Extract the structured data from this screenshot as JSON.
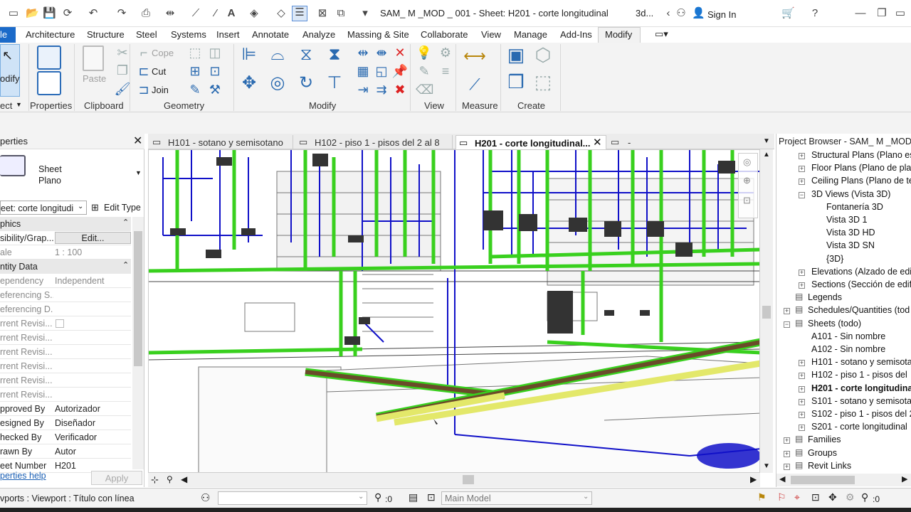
{
  "window_title": "SAM_ M _MOD _ 001 - Sheet: H201 - corte longitudinal",
  "title_extra": "3d...",
  "sign_in": "Sign In",
  "file_tab": "le",
  "tabs": [
    "Architecture",
    "Structure",
    "Steel",
    "Systems",
    "Insert",
    "Annotate",
    "Analyze",
    "Massing & Site",
    "Collaborate",
    "View",
    "Manage",
    "Add-Ins",
    "Modify"
  ],
  "ribbon": {
    "select_label": "odify",
    "select_group": "ect",
    "properties_label": "Properties",
    "clipboard": {
      "paste": "Paste",
      "copy": "Cope",
      "cut": "Cut",
      "join": "Join",
      "group": "Clipboard"
    },
    "geometry_group": "Geometry",
    "modify_group": "Modify",
    "view_group": "View",
    "measure_group": "Measure",
    "create_group": "Create"
  },
  "properties": {
    "title": "perties",
    "type_name": "Sheet",
    "type_sub": "Plano",
    "selector": "eet: corte longitudi",
    "edit_type": "Edit Type",
    "sections": [
      {
        "name": "phics"
      },
      {
        "name": "ntity Data"
      }
    ],
    "rows": [
      {
        "k": "sibility/Grap...",
        "v": "Edit..."
      },
      {
        "k": "ale",
        "v": "1 : 100"
      },
      {
        "k": "ependency",
        "v": "Independent"
      },
      {
        "k": "eferencing S...",
        "v": ""
      },
      {
        "k": "eferencing D...",
        "v": ""
      },
      {
        "k": "rrent Revisi...",
        "v": ""
      },
      {
        "k": "rrent Revisi...",
        "v": ""
      },
      {
        "k": "rrent Revisi...",
        "v": ""
      },
      {
        "k": "rrent Revisi...",
        "v": ""
      },
      {
        "k": "rrent Revisi...",
        "v": ""
      },
      {
        "k": "rrent Revisi...",
        "v": ""
      },
      {
        "k": "pproved By",
        "v": "Autorizador"
      },
      {
        "k": "esigned By",
        "v": "Diseñador"
      },
      {
        "k": "hecked By",
        "v": "Verificador"
      },
      {
        "k": "rawn By",
        "v": "Autor"
      },
      {
        "k": "eet Number",
        "v": "H201"
      }
    ],
    "help": "perties help",
    "apply": "Apply"
  },
  "view_tabs": [
    {
      "label": "H101 - sotano y semisotano"
    },
    {
      "label": "H102 - piso 1 -  pisos del 2 al 8"
    },
    {
      "label": "H201 - corte longitudinal..."
    },
    {
      "label": "-"
    }
  ],
  "project_browser": {
    "title": "Project Browser - SAM_ M _MOD...",
    "items": [
      {
        "label": "Structural Plans (Plano es",
        "indent": 1,
        "exp": "+"
      },
      {
        "label": "Floor Plans (Plano de plar",
        "indent": 1,
        "exp": "+"
      },
      {
        "label": "Ceiling Plans (Plano de te",
        "indent": 1,
        "exp": "+"
      },
      {
        "label": "3D Views (Vista 3D)",
        "indent": 1,
        "exp": "-"
      },
      {
        "label": "Fontanería 3D",
        "indent": 2,
        "exp": ""
      },
      {
        "label": "Vista 3D 1",
        "indent": 2,
        "exp": ""
      },
      {
        "label": "Vista 3D HD",
        "indent": 2,
        "exp": ""
      },
      {
        "label": "Vista 3D SN",
        "indent": 2,
        "exp": ""
      },
      {
        "label": "{3D}",
        "indent": 2,
        "exp": ""
      },
      {
        "label": "Elevations (Alzado de edi",
        "indent": 1,
        "exp": "+"
      },
      {
        "label": "Sections (Sección de edif",
        "indent": 1,
        "exp": "+"
      },
      {
        "label": "Legends",
        "indent": 0,
        "exp": ""
      },
      {
        "label": "Schedules/Quantities (tod",
        "indent": 0,
        "exp": "+"
      },
      {
        "label": "Sheets (todo)",
        "indent": 0,
        "exp": "-"
      },
      {
        "label": "A101 - Sin nombre",
        "indent": 1,
        "exp": ""
      },
      {
        "label": "A102 - Sin nombre",
        "indent": 1,
        "exp": ""
      },
      {
        "label": "H101 - sotano y semisota",
        "indent": 1,
        "exp": "+"
      },
      {
        "label": "H102 - piso 1 -  pisos del",
        "indent": 1,
        "exp": "+"
      },
      {
        "label": "H201 - corte longitudina",
        "indent": 1,
        "exp": "+",
        "bold": true
      },
      {
        "label": "S101 - sotano y semisotar",
        "indent": 1,
        "exp": "+"
      },
      {
        "label": "S102 - piso 1 - pisos del 2",
        "indent": 1,
        "exp": "+"
      },
      {
        "label": "S201 - corte longitudinal",
        "indent": 1,
        "exp": "+"
      },
      {
        "label": "Families",
        "indent": 0,
        "exp": "+"
      },
      {
        "label": "Groups",
        "indent": 0,
        "exp": "+"
      },
      {
        "label": "Revit Links",
        "indent": 0,
        "exp": "+"
      }
    ]
  },
  "status": {
    "left": "vports : Viewport : Título con línea",
    "count": ":0",
    "model": "Main Model",
    "right_count": ":0"
  },
  "colors": {
    "accent": "#1b6ac9",
    "pipe_green": "#39d01e",
    "pipe_blue": "#1010c8",
    "pipe_yellow": "#e3e86a"
  }
}
